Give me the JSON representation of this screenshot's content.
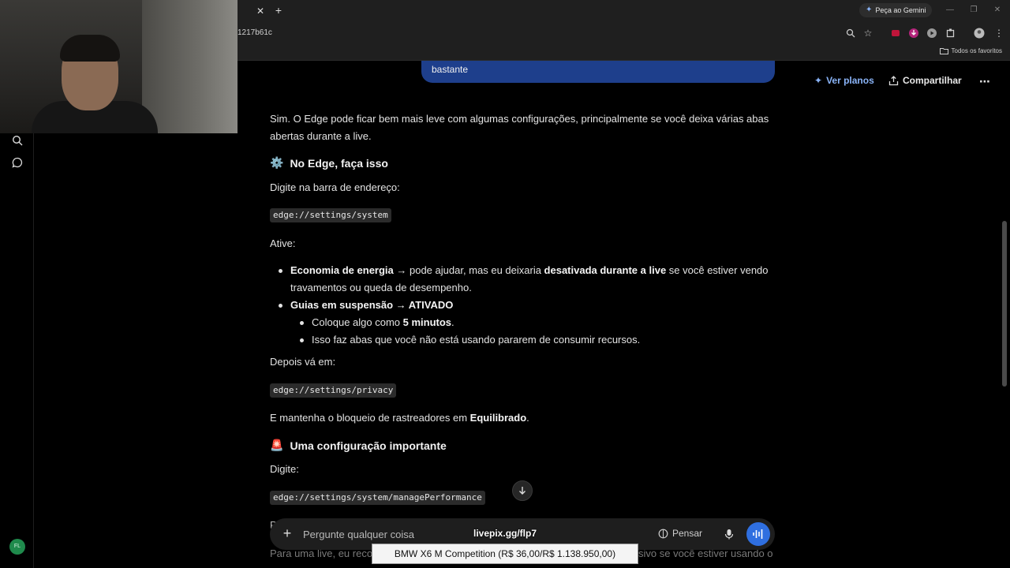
{
  "browser": {
    "url_fragment": "1217b61c",
    "gemini_button": "Peça ao Gemini",
    "bookmark_folder": "Todos os favoritos"
  },
  "header": {
    "plans": "Ver planos",
    "share": "Compartilhar"
  },
  "user_message_tail": "bastante",
  "answer": {
    "intro": "Sim. O Edge pode ficar bem mais leve com algumas configurações, principalmente se você deixa várias abas abertas durante a live.",
    "h1": "No Edge, faça isso",
    "step1": "Digite na barra de endereço:",
    "code1": "edge://settings/system",
    "enable": "Ative:",
    "b1_bold": "Economia de energia",
    "b1_rest": " → pode ajudar, mas eu deixaria ",
    "b1_bold2": "desativada durante a live",
    "b1_rest2": " se você estiver vendo",
    "b1_line2": "travamentos ou queda de desempenho.",
    "b2": "Guias em suspensão → ATIVADO",
    "sub1_a": "Coloque algo como ",
    "sub1_b": "5 minutos",
    "sub1_c": ".",
    "sub2": "Isso faz abas que você não está usando pararem de consumir recursos.",
    "then": "Depois vá em:",
    "code2": "edge://settings/privacy",
    "tracker_a": "E mantenha o bloqueio de rastreadores em ",
    "tracker_b": "Equilibrado",
    "tracker_c": ".",
    "h2": "Uma configuração importante",
    "type": "Digite:",
    "code3": "edge://settings/system/managePerformance",
    "cut_letter": "P",
    "cut_bottom_left": "Para uma live, eu reco",
    "cut_bottom_right": "sivo se você estiver usando o"
  },
  "composer": {
    "placeholder": "Pergunte qualquer coisa",
    "think": "Pensar"
  },
  "overlay": {
    "livepix": "livepix.gg/flp7",
    "donation": "BMW X6 M Competition (R$ 36,00/R$ 1.138.950,00)"
  },
  "user_initials": "FL",
  "colors": {
    "accent_blue": "#8ab4f8",
    "bubble": "#1e3f8c",
    "voice_button": "#2f6fe0",
    "avatar": "#1f8a4c"
  }
}
